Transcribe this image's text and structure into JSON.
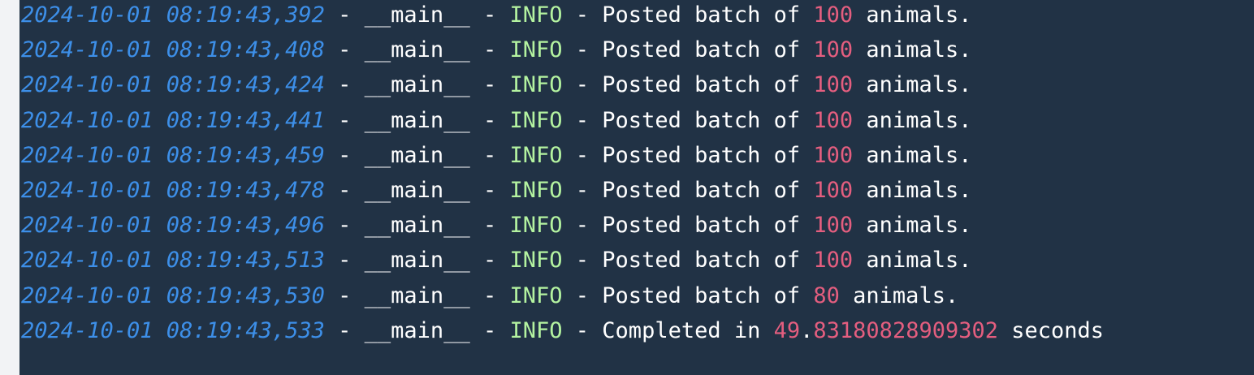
{
  "colors": {
    "background": "#213245",
    "timestamp": "#3d8fe8",
    "level": "#b4f3a0",
    "number": "#e45e7f",
    "text": "#ffffff"
  },
  "log_lines": [
    {
      "timestamp": "2024-10-01 08:19:43,392",
      "sep1": " - ",
      "logger": "__main__",
      "sep2": " - ",
      "level": "INFO",
      "sep3": " - ",
      "prefix": "Posted batch of ",
      "number": "100",
      "number_tail": "",
      "suffix": " animals."
    },
    {
      "timestamp": "2024-10-01 08:19:43,408",
      "sep1": " - ",
      "logger": "__main__",
      "sep2": " - ",
      "level": "INFO",
      "sep3": " - ",
      "prefix": "Posted batch of ",
      "number": "100",
      "number_tail": "",
      "suffix": " animals."
    },
    {
      "timestamp": "2024-10-01 08:19:43,424",
      "sep1": " - ",
      "logger": "__main__",
      "sep2": " - ",
      "level": "INFO",
      "sep3": " - ",
      "prefix": "Posted batch of ",
      "number": "100",
      "number_tail": "",
      "suffix": " animals."
    },
    {
      "timestamp": "2024-10-01 08:19:43,441",
      "sep1": " - ",
      "logger": "__main__",
      "sep2": " - ",
      "level": "INFO",
      "sep3": " - ",
      "prefix": "Posted batch of ",
      "number": "100",
      "number_tail": "",
      "suffix": " animals."
    },
    {
      "timestamp": "2024-10-01 08:19:43,459",
      "sep1": " - ",
      "logger": "__main__",
      "sep2": " - ",
      "level": "INFO",
      "sep3": " - ",
      "prefix": "Posted batch of ",
      "number": "100",
      "number_tail": "",
      "suffix": " animals."
    },
    {
      "timestamp": "2024-10-01 08:19:43,478",
      "sep1": " - ",
      "logger": "__main__",
      "sep2": " - ",
      "level": "INFO",
      "sep3": " - ",
      "prefix": "Posted batch of ",
      "number": "100",
      "number_tail": "",
      "suffix": " animals."
    },
    {
      "timestamp": "2024-10-01 08:19:43,496",
      "sep1": " - ",
      "logger": "__main__",
      "sep2": " - ",
      "level": "INFO",
      "sep3": " - ",
      "prefix": "Posted batch of ",
      "number": "100",
      "number_tail": "",
      "suffix": " animals."
    },
    {
      "timestamp": "2024-10-01 08:19:43,513",
      "sep1": " - ",
      "logger": "__main__",
      "sep2": " - ",
      "level": "INFO",
      "sep3": " - ",
      "prefix": "Posted batch of ",
      "number": "100",
      "number_tail": "",
      "suffix": " animals."
    },
    {
      "timestamp": "2024-10-01 08:19:43,530",
      "sep1": " - ",
      "logger": "__main__",
      "sep2": " - ",
      "level": "INFO",
      "sep3": " - ",
      "prefix": "Posted batch of ",
      "number": "80",
      "number_tail": "",
      "suffix": " animals."
    },
    {
      "timestamp": "2024-10-01 08:19:43,533",
      "sep1": " - ",
      "logger": "__main__",
      "sep2": " - ",
      "level": "INFO",
      "sep3": " - ",
      "prefix": "Completed in ",
      "number": "49",
      "number_tail": ".83180828909302",
      "suffix": " seconds"
    }
  ]
}
